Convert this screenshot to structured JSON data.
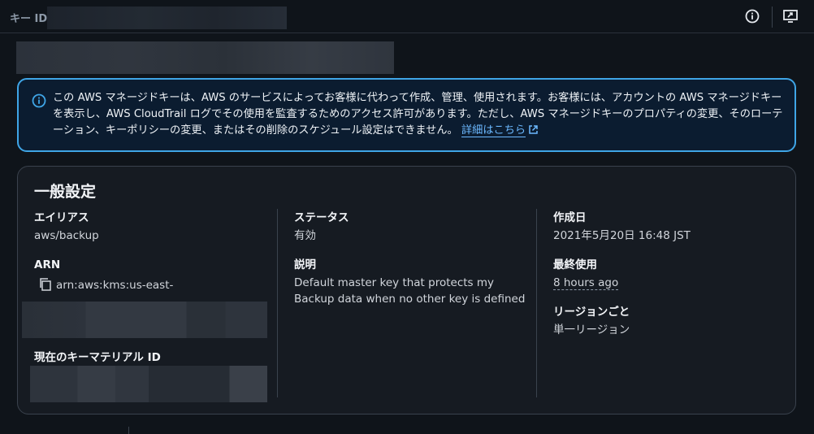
{
  "header": {
    "title": "キー ID",
    "icons": [
      "info-icon",
      "screen-share-icon"
    ]
  },
  "banner": {
    "text": "この AWS マネージドキーは、AWS のサービスによってお客様に代わって作成、管理、使用されます。お客様には、アカウントの AWS マネージドキーを表示し、AWS CloudTrail ログでその使用を監査するためのアクセス許可があります。ただし、AWS マネージドキーのプロパティの変更、そのローテーション、キーポリシーの変更、またはその削除のスケジュール設定はできません。",
    "link": "詳細はこちら",
    "accent_color": "#3fa5e6"
  },
  "general": {
    "title": "一般設定",
    "alias_label": "エイリアス",
    "alias_value": "aws/backup",
    "arn_label": "ARN",
    "arn_value": "arn:aws:kms:us-east-",
    "material_label": "現在のキーマテリアル ID",
    "status_label": "ステータス",
    "status_value": "有効",
    "desc_label": "説明",
    "desc_value_line1": "Default master key that protects my",
    "desc_value_line2": "Backup data when no other key is defined",
    "created_label": "作成日",
    "created_value": "2021年5月20日 16:48 JST",
    "last_used_label": "最終使用",
    "last_used_value": "8 hours ago",
    "region_label": "リージョンごと",
    "region_value": "単一リージョン"
  }
}
